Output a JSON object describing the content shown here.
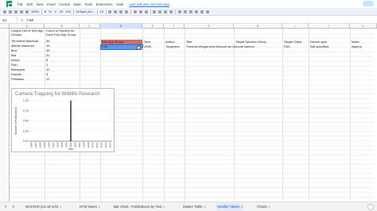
{
  "menubar": {
    "items": [
      "File",
      "Edit",
      "View",
      "Insert",
      "Format",
      "Data",
      "Tools",
      "Extensions",
      "Help"
    ],
    "last_edit": "Last edit was seconds ago"
  },
  "toolbar": {
    "zoom": "100%",
    "number_format_1": "$",
    "number_format_2": "%",
    "number_format_3": ".0",
    "number_format_4": ".00",
    "number_format_5": "123",
    "font": "Default (Ari...",
    "font_size": "10"
  },
  "formula_bar": {
    "cell_ref": "G1",
    "fx": "fx",
    "value": "Fish"
  },
  "columns": [
    "A",
    "B",
    "C",
    "D",
    "E",
    "F",
    "G",
    "H",
    "I",
    "J",
    "K",
    "L"
  ],
  "summary_table": {
    "header_a": "Unique List of Key App Groups",
    "header_b": "Count of Studies for Each Key App Group",
    "rows": [
      [
        "Terrestrial Mammal",
        "56"
      ],
      [
        "Marine Mammal",
        "19"
      ],
      [
        "Bird",
        "45"
      ],
      [
        "Bat",
        "31"
      ],
      [
        "Insect",
        "8"
      ],
      [
        "Fish",
        "1"
      ],
      [
        "Marsupial",
        "12"
      ],
      [
        "Human",
        "5"
      ],
      [
        "Primates",
        "12"
      ]
    ]
  },
  "filtered_table": {
    "headers": [
      "Key App Group",
      "Year",
      "Author",
      "Title",
      "Target Species Group",
      "Target Class",
      "Device type",
      "Make"
    ],
    "row": [
      "Fish",
      "1995",
      "Torgersen",
      "Thermal refugia and chinook sa Chinook salmon",
      "",
      "Fish",
      "Not specified",
      "Agema"
    ]
  },
  "chart_data": {
    "type": "bar",
    "title": "Camera Trapping for Wildlife Research",
    "xlabel": "Year",
    "ylabel": "Number of Publications",
    "yticks": [
      "0.00",
      "0.25",
      "0.50",
      "0.75",
      "1.00"
    ],
    "ylim": [
      0,
      1
    ],
    "categories": [
      "1986",
      "1987",
      "1988",
      "1989",
      "1990",
      "1991",
      "1992",
      "1993",
      "1994",
      "1995",
      "1996",
      "1997",
      "1998",
      "1999",
      "2000",
      "2001",
      "2002",
      "2003",
      "2004"
    ],
    "values": [
      0,
      0,
      0,
      0,
      0,
      0,
      0,
      0,
      0,
      1,
      0,
      0,
      0,
      0,
      0,
      0,
      0,
      0,
      0
    ],
    "bar_color": "#000000"
  },
  "sheet_tabs": [
    {
      "label": "MASTER (inc all refs)",
      "active": false
    },
    {
      "label": "KFW Notes",
      "active": false
    },
    {
      "label": "Bar Chart - Publications by Year",
      "active": false
    },
    {
      "label": "Master Table",
      "active": false
    },
    {
      "label": "Smaller Tables",
      "active": true
    },
    {
      "label": "Charts",
      "active": false
    }
  ],
  "icons": {
    "add_sheet": "plus-icon",
    "all_sheets": "menu-icon",
    "explore": "explore-icon"
  },
  "colors": {
    "header_fill": "#c9706b",
    "selection_fill": "#6d9eeb",
    "accent": "#1a73e8",
    "sheets_green": "#0f9d58"
  }
}
